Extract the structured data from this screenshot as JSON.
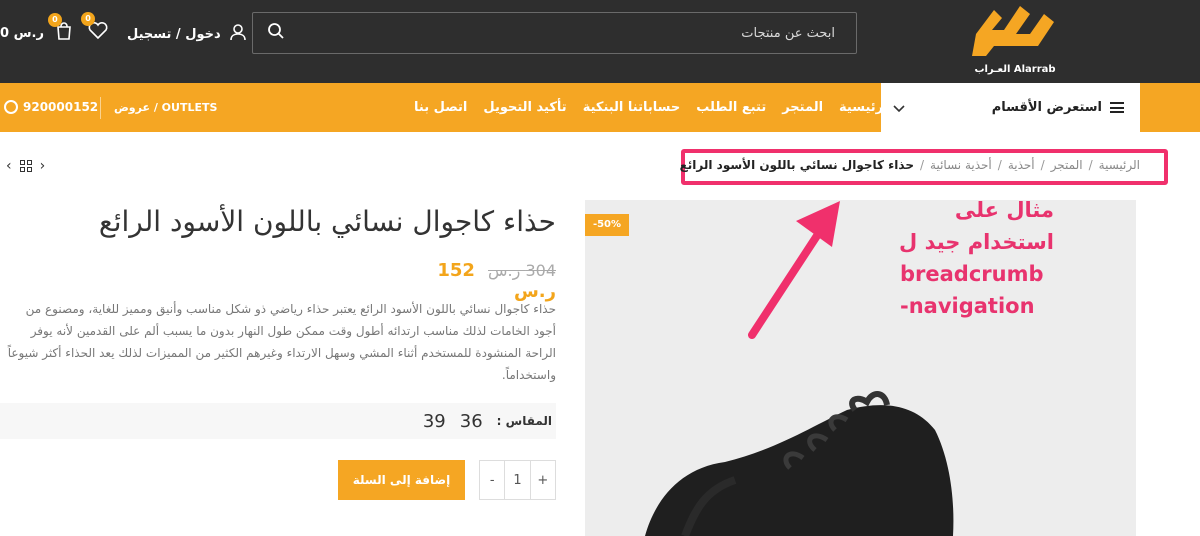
{
  "header": {
    "logo_text": "العـراب Alarrab",
    "search_placeholder": "ابحث عن منتجات",
    "login_label": "دخول / تسجيل",
    "wishlist_count": "0",
    "cart_count": "0",
    "cart_amount": "0 ر.س"
  },
  "nav": {
    "categories_label": "استعرض الأقسام",
    "links": [
      "الرئيسية",
      "المتجر",
      "تتبع الطلب",
      "حساباتنا البنكية",
      "تأكيد التحويل",
      "اتصل بنا"
    ],
    "outlets_label": "OUTLETS / عروض",
    "phone": "920000152"
  },
  "breadcrumb": {
    "items": [
      "الرئيسية",
      "المتجر",
      "أحذية",
      "أحذية نسائية"
    ],
    "current": "حذاء كاجوال نسائي باللون الأسود الرائع"
  },
  "annotation": {
    "line1": "مثال على",
    "line2": "استخدام جيد ل",
    "line3": "breadcrumb",
    "line4": "-navigation"
  },
  "product": {
    "sale_badge": "-50%",
    "title": "حذاء كاجوال نسائي باللون الأسود الرائع",
    "old_price": "304 ر.س",
    "new_price": "152 ر.س",
    "description": "حذاء كاجوال نسائي باللون الأسود الرائع يعتبر حذاء رياضي ذو شكل مناسب وأنيق ومميز للغاية، ومصنوع من أجود الخامات لذلك مناسب ارتدائه أطول وقت ممكن طول النهار بدون ما يسبب ألم على القدمين لأنه يوفر الراحة المنشودة للمستخدم أثناء المشي وسهل الارتداء وغيرهم الكثير من المميزات لذلك يعد الحذاء أكثر شيوعاً واستخداماً.",
    "size_label": "المقاس :",
    "sizes": [
      "36",
      "39"
    ],
    "quantity": "1",
    "qty_plus": "+",
    "qty_minus": "-",
    "add_to_cart": "إضافة إلى السلة"
  },
  "colors": {
    "accent": "#f5a623",
    "header_bg": "#2e2e2e",
    "highlight": "#f0306c"
  }
}
